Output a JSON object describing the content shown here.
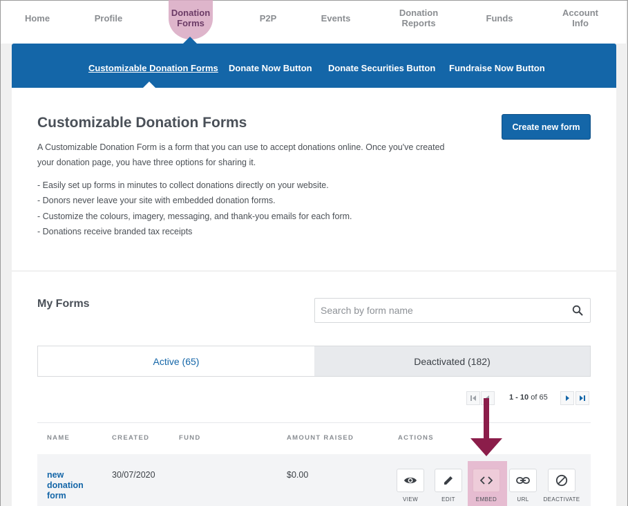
{
  "topnav": {
    "items": [
      {
        "line1": "Home",
        "line2": ""
      },
      {
        "line1": "Profile",
        "line2": ""
      },
      {
        "line1": "Donation",
        "line2": "Forms"
      },
      {
        "line1": "P2P",
        "line2": ""
      },
      {
        "line1": "Events",
        "line2": ""
      },
      {
        "line1": "Donation",
        "line2": "Reports"
      },
      {
        "line1": "Funds",
        "line2": ""
      },
      {
        "line1": "Account",
        "line2": "Info"
      }
    ],
    "active_index": 2
  },
  "subnav": {
    "items": [
      "Customizable Donation Forms",
      "Donate Now Button",
      "Donate Securities Button",
      "Fundraise Now Button"
    ],
    "active_index": 0
  },
  "intro_card": {
    "title": "Customizable Donation Forms",
    "description_line1": "A Customizable Donation Form is a form that you can use to accept donations online. Once you've created",
    "description_line2": "your donation page, you have three options for sharing it.",
    "bullets": [
      "- Easily set up forms in minutes to collect donations directly on your website.",
      "- Donors never leave your site with embedded donation forms.",
      "- Customize the colours, imagery, messaging, and thank-you emails for each form.",
      "- Donations receive branded tax receipts"
    ],
    "create_button": "Create new form"
  },
  "my_forms": {
    "title": "My Forms",
    "search": {
      "placeholder": "Search by form name",
      "value": ""
    },
    "tabs": {
      "active": "Active (65)",
      "inactive": "Deactivated (182)"
    },
    "pagination": {
      "range": "1 - 10",
      "of_label": "of",
      "total": "65"
    },
    "columns": [
      "NAME",
      "CREATED",
      "FUND",
      "AMOUNT RAISED",
      "ACTIONS"
    ],
    "rows": [
      {
        "name_line1": "new",
        "name_line2": "donation",
        "name_line3": "form",
        "created": "30/07/2020",
        "fund": "",
        "amount_raised": "$0.00"
      }
    ],
    "actions": [
      "VIEW",
      "EDIT",
      "EMBED",
      "URL",
      "DEACTIVATE"
    ],
    "icons": {
      "search": "search-icon",
      "first_page": "first-page-icon",
      "prev_page": "prev-page-icon",
      "next_page": "next-page-icon",
      "last_page": "last-page-icon",
      "view": "eye-icon",
      "edit": "pencil-icon",
      "embed": "code-icon",
      "url": "link-icon",
      "deactivate": "block-icon"
    }
  },
  "colors": {
    "brand_blue": "#1466a8",
    "highlight_pink": "#d9a9c2",
    "arrow": "#8b1d4a"
  }
}
